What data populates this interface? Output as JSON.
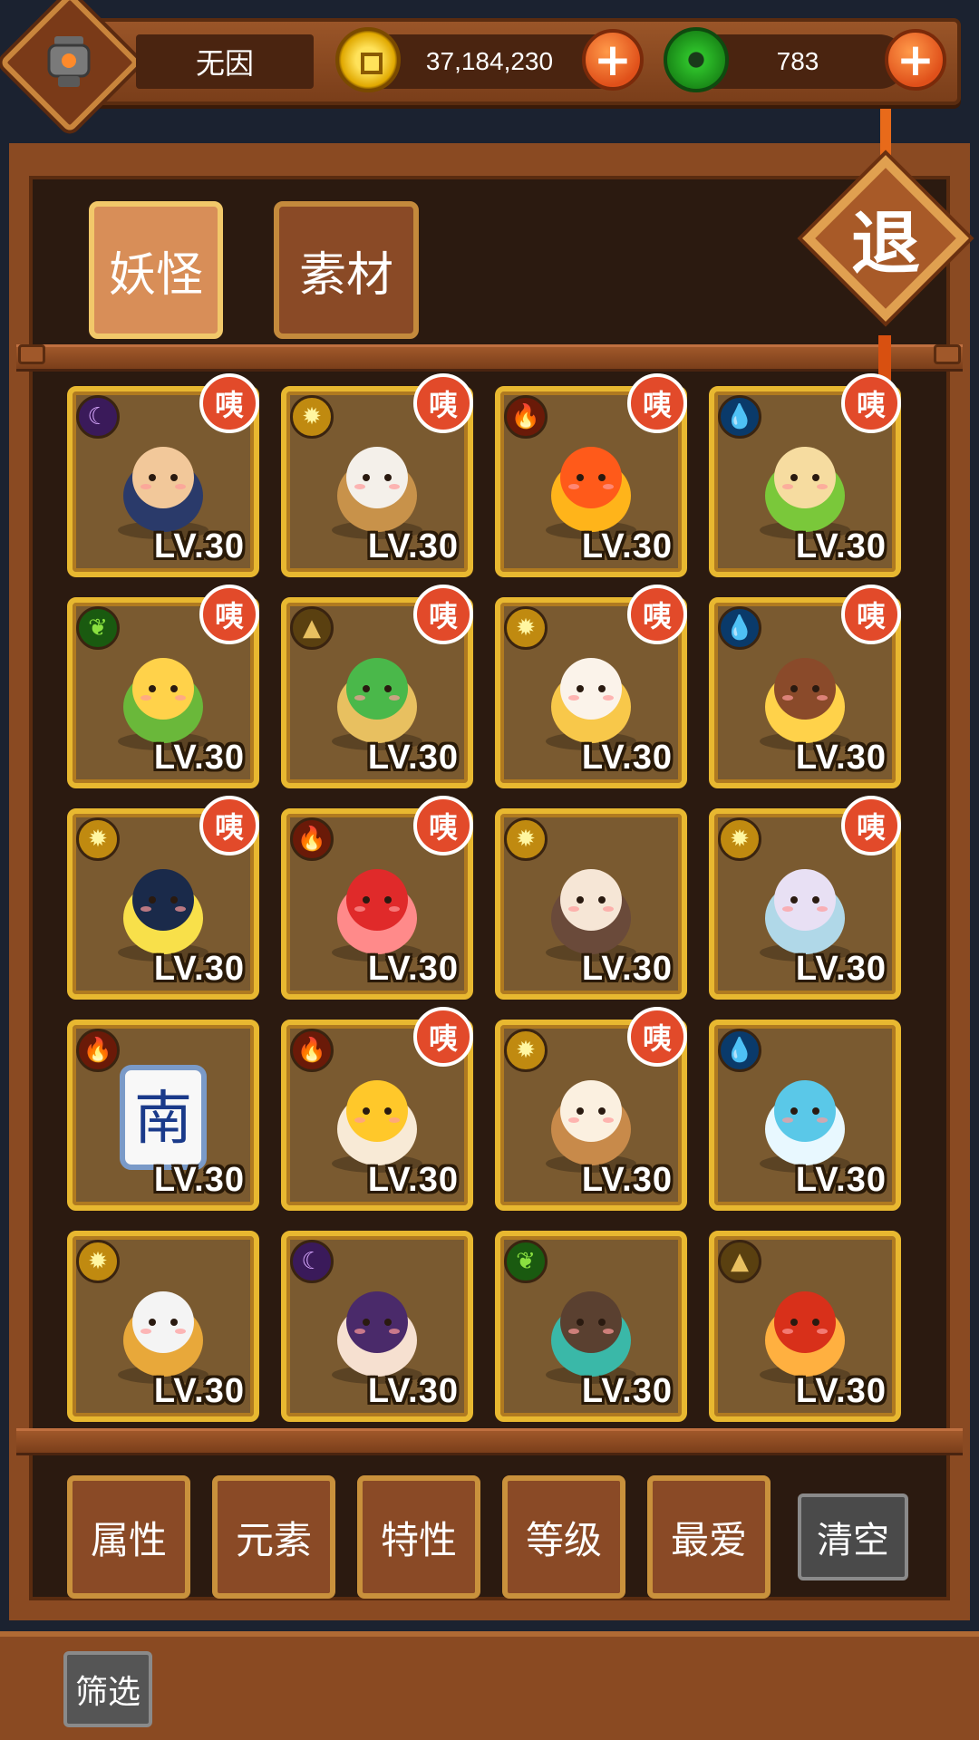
{
  "header": {
    "player_name": "无因",
    "gold_amount": "37,184,230",
    "jade_amount": "783",
    "plus_label": "+"
  },
  "tabs": [
    {
      "label": "妖怪",
      "active": true
    },
    {
      "label": "素材",
      "active": false
    }
  ],
  "exit_label": "退",
  "cards": [
    {
      "element": "moon",
      "art": "scholar-icon",
      "level": "LV.30",
      "badge": "咦"
    },
    {
      "element": "sun",
      "art": "mouse-in-box-icon",
      "level": "LV.30",
      "badge": "咦"
    },
    {
      "element": "fire",
      "art": "flame-spirit-icon",
      "level": "LV.30",
      "badge": "咦"
    },
    {
      "element": "water",
      "art": "sprout-icon",
      "level": "LV.30",
      "badge": "咦"
    },
    {
      "element": "leaf",
      "art": "corn-icon",
      "level": "LV.30",
      "badge": "咦"
    },
    {
      "element": "earth",
      "art": "cactus-icon",
      "level": "LV.30",
      "badge": "咦"
    },
    {
      "element": "sun",
      "art": "candle-ghost-icon",
      "level": "LV.30",
      "badge": "咦"
    },
    {
      "element": "water",
      "art": "cannon-chick-icon",
      "level": "LV.30",
      "badge": "咦"
    },
    {
      "element": "sun",
      "art": "night-cloth-icon",
      "level": "LV.30",
      "badge": "咦"
    },
    {
      "element": "fire",
      "art": "yarn-ball-icon",
      "level": "LV.30",
      "badge": "咦"
    },
    {
      "element": "sun",
      "art": "lady-icon",
      "level": "LV.30",
      "badge": ""
    },
    {
      "element": "sun",
      "art": "cloud-spirit-icon",
      "level": "LV.30",
      "badge": "咦"
    },
    {
      "element": "fire",
      "art": "mahjong-tile-icon",
      "level": "LV.30",
      "badge": ""
    },
    {
      "element": "fire",
      "art": "gold-ingot-icon",
      "level": "LV.30",
      "badge": "咦"
    },
    {
      "element": "sun",
      "art": "dumpling-deer-icon",
      "level": "LV.30",
      "badge": "咦"
    },
    {
      "element": "water",
      "art": "water-sage-icon",
      "level": "LV.30",
      "badge": ""
    },
    {
      "element": "sun",
      "art": "fox-boy-icon",
      "level": "LV.30",
      "badge": ""
    },
    {
      "element": "moon",
      "art": "cat-maiden-icon",
      "level": "LV.30",
      "badge": ""
    },
    {
      "element": "leaf",
      "art": "bearded-warrior-icon",
      "level": "LV.30",
      "badge": ""
    },
    {
      "element": "earth",
      "art": "red-hair-fighter-icon",
      "level": "LV.30",
      "badge": ""
    }
  ],
  "mahjong_char": "南",
  "filters": [
    {
      "label": "属性"
    },
    {
      "label": "元素"
    },
    {
      "label": "特性"
    },
    {
      "label": "等级"
    },
    {
      "label": "最爱"
    }
  ],
  "clear_label": "清空",
  "screen_label": "筛选",
  "element_glyphs": {
    "moon": "☾",
    "sun": "✹",
    "fire": "🔥",
    "water": "💧",
    "leaf": "❦",
    "earth": "▲"
  },
  "colors": {
    "frame": "#8a4a22",
    "card_border": "#e8b830",
    "badge": "#e24a2a"
  }
}
